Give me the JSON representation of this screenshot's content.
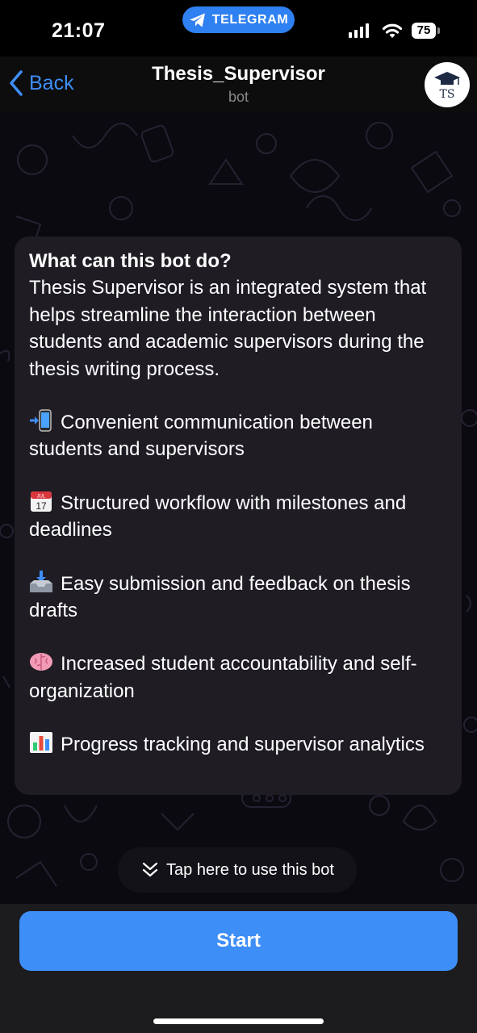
{
  "status_bar": {
    "time": "21:07",
    "app_pill": "TELEGRAM",
    "battery": "75"
  },
  "nav": {
    "back_label": "Back",
    "title": "Thesis_Supervisor",
    "subtitle": "bot",
    "avatar_text": "TS"
  },
  "bubble": {
    "heading": "What can this bot do?",
    "intro": "Thesis Supervisor is an integrated system that helps streamline the interaction between students and academic supervisors during the thesis writing process.",
    "features": [
      {
        "icon": "phone-arrow-icon",
        "text": "Convenient communication between students and supervisors"
      },
      {
        "icon": "calendar-icon",
        "calendar_month": "JUL",
        "calendar_day": "17",
        "text": "Structured workflow with milestones and deadlines"
      },
      {
        "icon": "inbox-tray-icon",
        "text": "Easy submission and feedback on thesis drafts"
      },
      {
        "icon": "brain-icon",
        "text": "Increased student accountability and self-organization"
      },
      {
        "icon": "bar-chart-icon",
        "text": "Progress tracking and supervisor analytics"
      }
    ]
  },
  "hint": {
    "label": "Tap here to use this bot"
  },
  "start_button": {
    "label": "Start"
  },
  "colors": {
    "accent": "#3e8ef7",
    "bubble": "#1f1c24",
    "pill": "#2f80f0"
  }
}
